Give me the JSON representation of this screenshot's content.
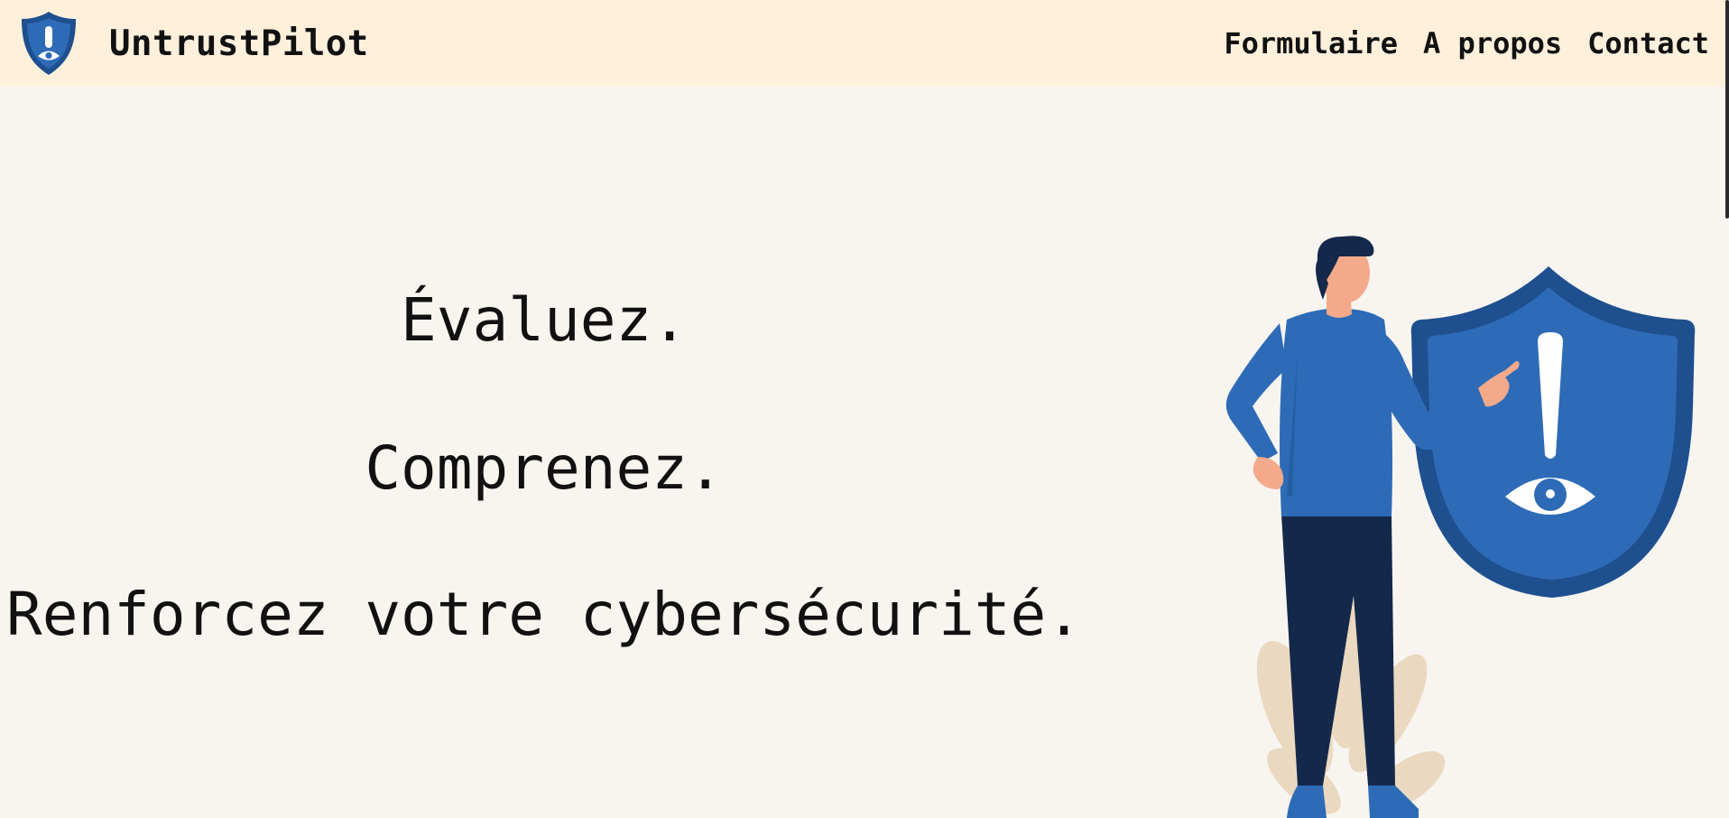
{
  "header": {
    "brand_name": "UntrustPilot",
    "logo_icon": "shield-exclamation-eye-icon",
    "nav": [
      {
        "label": "Formulaire"
      },
      {
        "label": "A propos"
      },
      {
        "label": "Contact"
      }
    ]
  },
  "hero": {
    "line1": "Évaluez.",
    "line2": "Comprenez.",
    "line3": "Renforcez votre cybersécurité.",
    "illustration_icon": "man-pointing-at-security-shield-illustration"
  },
  "colors": {
    "header_bg": "#fff0dc",
    "page_bg": "#f8f5f0",
    "shield_outer": "#1e4f8f",
    "shield_inner": "#2e6bb7",
    "shirt": "#2e6bb7",
    "pants": "#14284a",
    "skin": "#f4a98a",
    "plant": "#ead9c0"
  }
}
